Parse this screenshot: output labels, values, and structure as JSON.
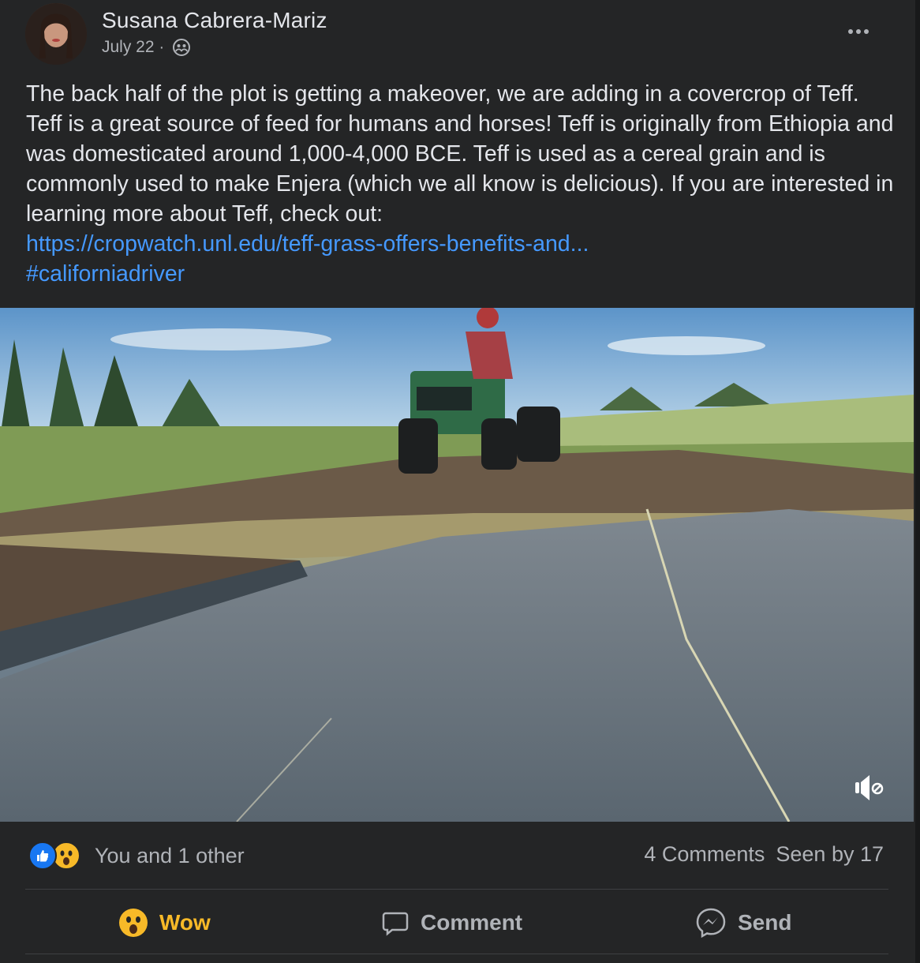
{
  "post": {
    "author": "Susana Cabrera-Mariz",
    "date": "July 22",
    "separator": "·",
    "audience_icon": "friends-icon",
    "more_icon": "more-options-icon",
    "text": "The back half of the plot is getting a makeover, we are adding in a covercrop of Teff. Teff is a great source of feed for humans and horses! Teff is originally from Ethiopia and was domesticated around 1,000-4,000 BCE. Teff is used as a cereal grain and is commonly used to make Enjera (which we all know is delicious). If you are interested in learning more about Teff, check out:",
    "link": "https://cropwatch.unl.edu/teff-grass-offers-benefits-and...",
    "hashtag": "#californiadriver",
    "media_sound_icon": "sound-off-icon"
  },
  "reactions": {
    "icons": [
      "like-icon",
      "wow-icon"
    ],
    "summary": "You and 1 other",
    "comments": "4 Comments",
    "seen": "Seen by 17"
  },
  "actions": {
    "wow_label": "Wow",
    "comment_label": "Comment",
    "send_label": "Send"
  },
  "colors": {
    "background": "#242526",
    "link": "#4599ff",
    "wow": "#f7b928",
    "like": "#1877f2",
    "secondary_text": "#b0b3b8"
  }
}
